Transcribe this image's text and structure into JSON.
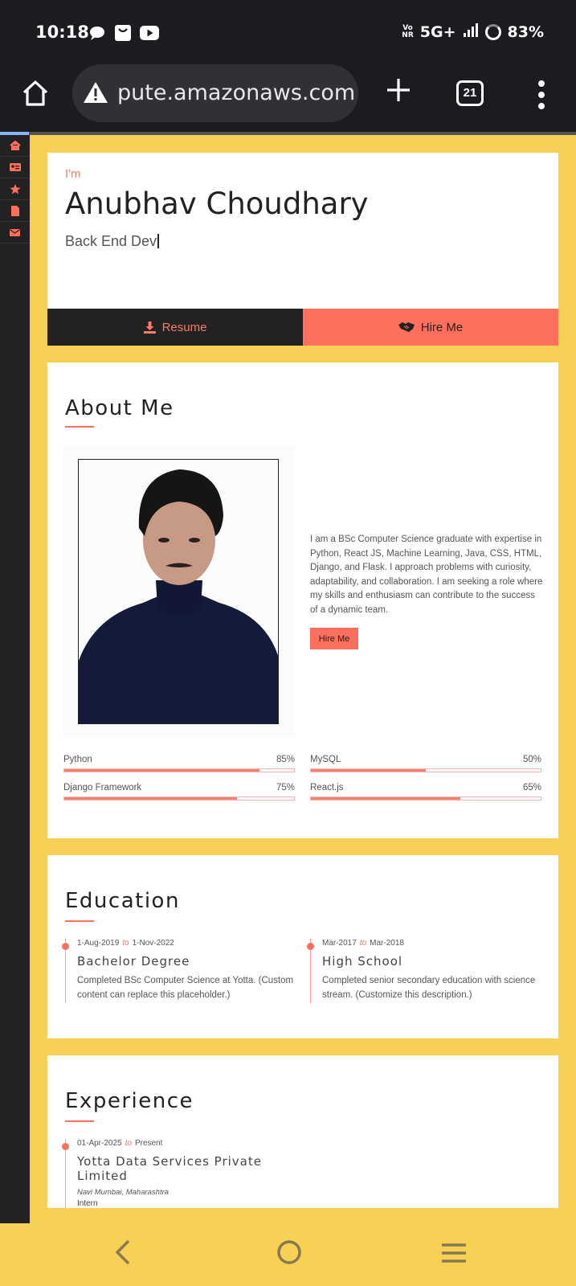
{
  "status_bar": {
    "time": "10:18",
    "network": "5G+",
    "volte_top": "Vo",
    "volte_bottom": "NR",
    "battery": "83%",
    "notification_icons": [
      "chat-bubble-icon",
      "shopping-bag-icon",
      "youtube-icon"
    ]
  },
  "browser": {
    "url": "pute.amazonaws.com",
    "tab_count": "21"
  },
  "sidebar": {
    "items": [
      "home-icon",
      "id-card-icon",
      "star-icon",
      "file-icon",
      "envelope-icon"
    ]
  },
  "hero": {
    "intro": "I'm",
    "name": "Anubhav Choudhary",
    "role": "Back End Dev",
    "resume_label": "Resume",
    "hire_label": "Hire Me"
  },
  "about": {
    "title": "About Me",
    "text": "I am a BSc Computer Science graduate with expertise in Python, React JS, Machine Learning, Java, CSS, HTML, Django, and Flask. I approach problems with curiosity, adaptability, and collaboration. I am seeking a role where my skills and enthusiasm can contribute to the success of a dynamic team.",
    "hire_label": "Hire Me",
    "skills": [
      {
        "name": "Python",
        "percent_label": "85%",
        "value": 85
      },
      {
        "name": "MySQL",
        "percent_label": "50%",
        "value": 50
      },
      {
        "name": "Django Framework",
        "percent_label": "75%",
        "value": 75
      },
      {
        "name": "React.js",
        "percent_label": "65%",
        "value": 65
      }
    ]
  },
  "education": {
    "title": "Education",
    "items": [
      {
        "from": "1-Aug-2019",
        "to_word": "to",
        "to": "1-Nov-2022",
        "title": "Bachelor Degree",
        "desc": "Completed BSc Computer Science at Yotta. (Custom content can replace this placeholder.)"
      },
      {
        "from": "Mar-2017",
        "to_word": "to",
        "to": "Mar-2018",
        "title": "High School",
        "desc": "Completed senior secondary education with science stream. (Customize this description.)"
      }
    ]
  },
  "experience": {
    "title": "Experience",
    "items": [
      {
        "from": "01-Apr-2025",
        "to_word": "to",
        "to": "Present",
        "title": "Yotta Data Services Private Limited",
        "place": "Navi Mumbai, Maharashtra",
        "role": "Intern"
      }
    ]
  },
  "colors": {
    "accent": "#ff6f5e",
    "page_background": "#f6d155",
    "dark": "#222222"
  }
}
